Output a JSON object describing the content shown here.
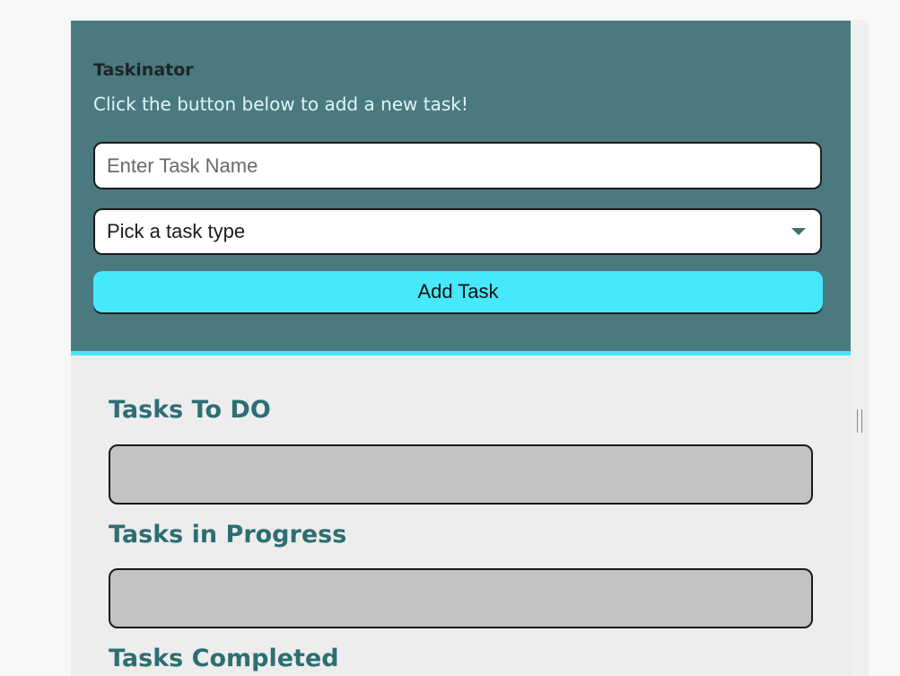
{
  "header": {
    "title": "Taskinator",
    "subtitle": "Click the button below to add a new task!"
  },
  "form": {
    "task_name_placeholder": "Enter Task Name",
    "task_name_value": "",
    "task_type_selected": "Pick a task type",
    "add_button_label": "Add Task"
  },
  "sections": [
    {
      "title": "Tasks To DO"
    },
    {
      "title": "Tasks in Progress"
    },
    {
      "title": "Tasks Completed"
    }
  ],
  "colors": {
    "header_bg": "#4a7a80",
    "accent": "#46e8fb",
    "section_title": "#2d6e73",
    "list_bg": "#c3c3c3"
  },
  "icons": {
    "select_caret": "caret-down-icon"
  }
}
